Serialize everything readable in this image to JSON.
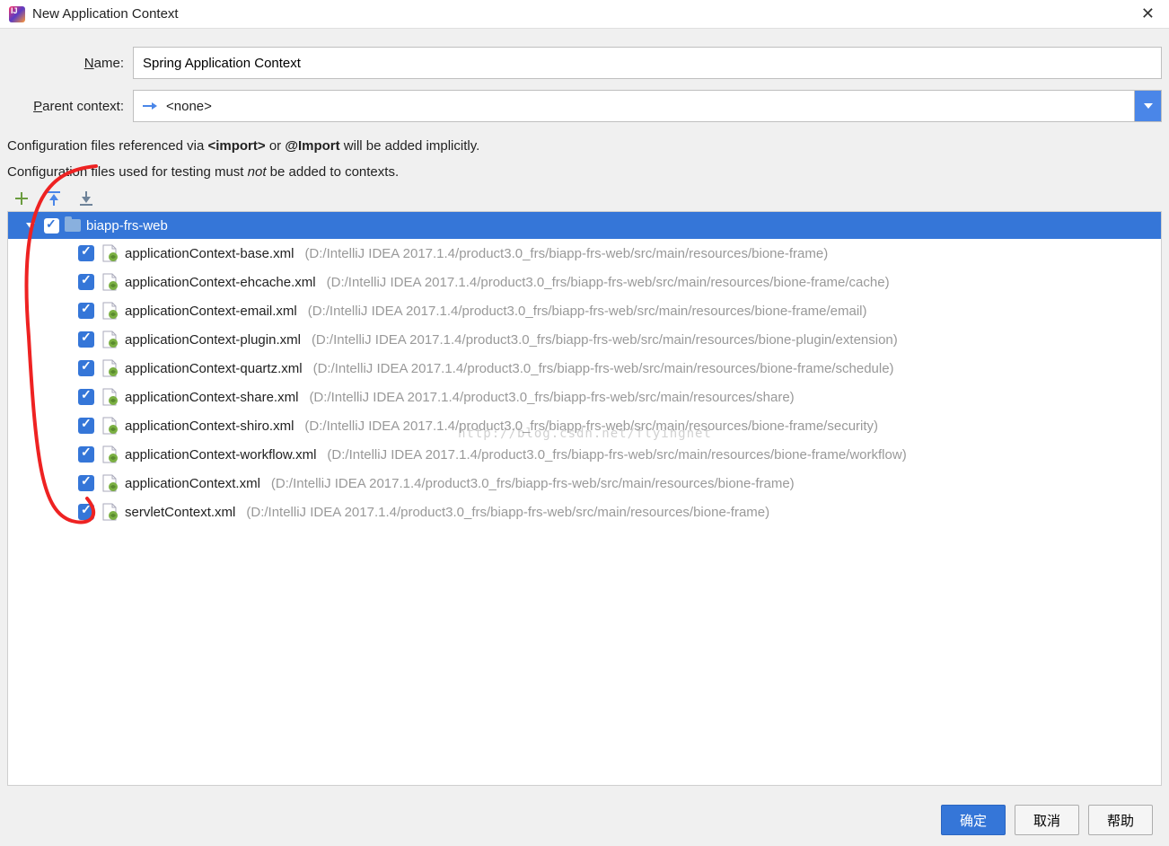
{
  "window": {
    "title": "New Application Context"
  },
  "form": {
    "name_label_pre": "N",
    "name_label_post": "ame:",
    "name_value": "Spring Application Context",
    "parent_label_pre": "P",
    "parent_label_post": "arent context:",
    "parent_value": "<none>"
  },
  "info": {
    "line1_a": "Configuration files referenced via ",
    "line1_b": "<import>",
    "line1_c": " or ",
    "line1_d": "@Import",
    "line1_e": " will be added implicitly.",
    "line2_a": "Configuration files used for testing must ",
    "line2_b": "not",
    "line2_c": " be added to contexts."
  },
  "tree": {
    "root": "biapp-frs-web",
    "files": [
      {
        "name": "applicationContext-base.xml",
        "path": "(D:/IntelliJ IDEA 2017.1.4/product3.0_frs/biapp-frs-web/src/main/resources/bione-frame)",
        "spring": true
      },
      {
        "name": "applicationContext-ehcache.xml",
        "path": "(D:/IntelliJ IDEA 2017.1.4/product3.0_frs/biapp-frs-web/src/main/resources/bione-frame/cache)",
        "spring": true
      },
      {
        "name": "applicationContext-email.xml",
        "path": "(D:/IntelliJ IDEA 2017.1.4/product3.0_frs/biapp-frs-web/src/main/resources/bione-frame/email)",
        "spring": true
      },
      {
        "name": "applicationContext-plugin.xml",
        "path": "(D:/IntelliJ IDEA 2017.1.4/product3.0_frs/biapp-frs-web/src/main/resources/bione-plugin/extension)",
        "spring": true
      },
      {
        "name": "applicationContext-quartz.xml",
        "path": "(D:/IntelliJ IDEA 2017.1.4/product3.0_frs/biapp-frs-web/src/main/resources/bione-frame/schedule)",
        "spring": true
      },
      {
        "name": "applicationContext-share.xml",
        "path": "(D:/IntelliJ IDEA 2017.1.4/product3.0_frs/biapp-frs-web/src/main/resources/share)",
        "spring": true
      },
      {
        "name": "applicationContext-shiro.xml",
        "path": "(D:/IntelliJ IDEA 2017.1.4/product3.0_frs/biapp-frs-web/src/main/resources/bione-frame/security)",
        "spring": true
      },
      {
        "name": "applicationContext-workflow.xml",
        "path": "(D:/IntelliJ IDEA 2017.1.4/product3.0_frs/biapp-frs-web/src/main/resources/bione-frame/workflow)",
        "spring": true
      },
      {
        "name": "applicationContext.xml",
        "path": "(D:/IntelliJ IDEA 2017.1.4/product3.0_frs/biapp-frs-web/src/main/resources/bione-frame)",
        "spring": true
      },
      {
        "name": "servletContext.xml",
        "path": "(D:/IntelliJ IDEA 2017.1.4/product3.0_frs/biapp-frs-web/src/main/resources/bione-frame)",
        "spring": true
      }
    ]
  },
  "buttons": {
    "ok": "确定",
    "cancel": "取消",
    "help": "帮助"
  },
  "watermark": "http://blog.csdn.net/flyingnet"
}
